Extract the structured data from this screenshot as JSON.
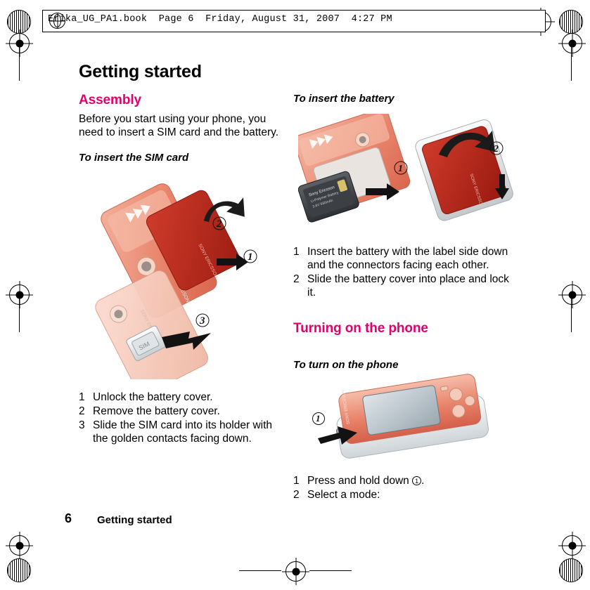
{
  "header": {
    "text": "Erika_UG_PA1.book  Page 6  Friday, August 31, 2007  4:27 PM",
    "globe_icon": "globe-icon"
  },
  "page_title": "Getting started",
  "left_column": {
    "section_title": "Assembly",
    "intro": "Before you start using your phone, you need to insert a SIM card and the battery.",
    "procedure_title": "To insert the SIM card",
    "figure_alt": "phone-sim-insert-illustration",
    "steps": [
      {
        "num": "1",
        "text": "Unlock the battery cover."
      },
      {
        "num": "2",
        "text": "Remove the battery cover."
      },
      {
        "num": "3",
        "text": "Slide the SIM card into its holder with the golden contacts facing down."
      }
    ]
  },
  "right_column": {
    "procedure_title_1": "To insert the battery",
    "figure_alt_1": "phone-battery-insert-illustration",
    "steps_1": [
      {
        "num": "1",
        "text": "Insert the battery with the label side down and the connectors facing each other."
      },
      {
        "num": "2",
        "text": "Slide the battery cover into place and lock it."
      }
    ],
    "section_title": "Turning on the phone",
    "procedure_title_2": "To turn on the phone",
    "figure_alt_2": "phone-power-button-illustration",
    "steps_2": [
      {
        "num": "1",
        "text_before": "Press and hold down ",
        "text_after": "."
      },
      {
        "num": "2",
        "text_before": "Select a mode:",
        "text_after": ""
      }
    ]
  },
  "footer": {
    "page_number": "6",
    "chapter": "Getting started"
  },
  "colors": {
    "heading_accent": "#e4006b",
    "phone_body": "#e8836a",
    "phone_dark": "#c0392b",
    "phone_light": "#f6c6b4"
  }
}
